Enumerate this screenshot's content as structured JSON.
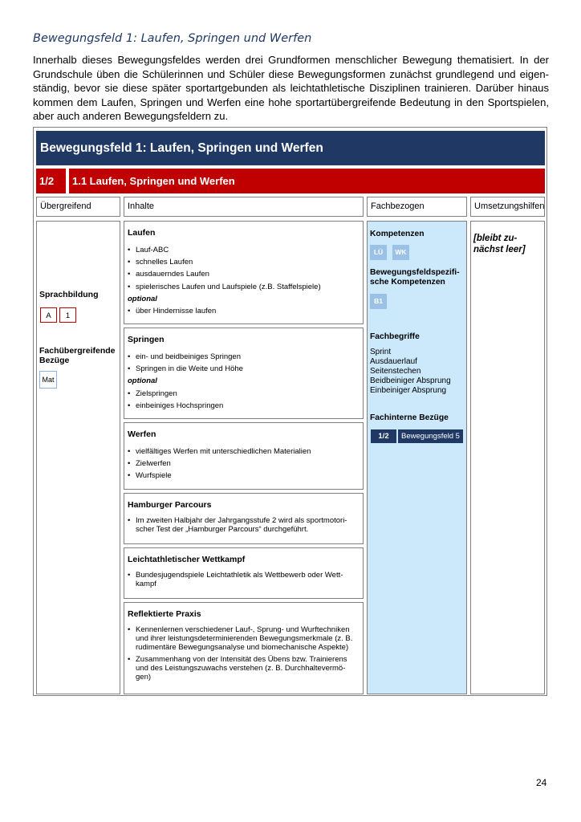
{
  "heading": "Bewegungsfeld 1: Laufen, Springen und Werfen",
  "intro": [
    "Innerhalb dieses Bewegungsfeldes werden drei Grundformen menschlicher Bewegung thematisiert. In der",
    "Grundschule üben die Schülerinnen und Schüler diese Bewegungsformen zunächst grundlegend und eigen-",
    "ständig, bevor sie diese später sportartgebunden als leichtathletische Disziplinen trainieren. Darüber hinaus",
    "kommen dem Laufen, Springen und Werfen eine hohe sportartübergreifende Bedeutung in den Sportspielen,",
    "aber auch anderen Bewegungsfeldern zu."
  ],
  "table": {
    "title": "Bewegungsfeld 1: Laufen, Springen und Werfen",
    "unit_number": "1/2",
    "unit_title": "1.1 Laufen, Springen und Werfen",
    "columns": [
      "Übergreifend",
      "Inhalte",
      "Fachbezogen",
      "Umsetzungshilfen"
    ],
    "uebergreifend": {
      "sprachbildung_label": "Sprachbildung",
      "sprachbildung_tags": [
        "A",
        "1"
      ],
      "fachuebergreifend_label": [
        "Fachübergreifende",
        "Bezüge"
      ],
      "fachuebergreifend_tag": "Mat"
    },
    "inhalte": [
      {
        "title": "Laufen",
        "items": [
          {
            "text": "Lauf-ABC"
          },
          {
            "text": "schnelles Laufen"
          },
          {
            "text": "ausdauerndes Laufen"
          },
          {
            "text": "spielerisches Laufen und Laufspiele (z.B. Staffelspiele)"
          },
          {
            "text": "optional",
            "optional": true
          },
          {
            "text": "über Hindernisse laufen"
          }
        ]
      },
      {
        "title": "Springen",
        "items": [
          {
            "text": "ein- und beidbeiniges Springen"
          },
          {
            "text": "Springen in die Weite und Höhe"
          },
          {
            "text": "optional",
            "optional": true
          },
          {
            "text": "Zielspringen"
          },
          {
            "text": "einbeiniges Hochspringen"
          }
        ]
      },
      {
        "title": "Werfen",
        "items": [
          {
            "text": "vielfältiges Werfen mit unterschiedlichen Materialien"
          },
          {
            "text": "Zielwerfen"
          },
          {
            "text": "Wurfspiele"
          }
        ]
      },
      {
        "title": "Hamburger Parcours",
        "items": [
          {
            "text": "Im zweiten Halbjahr der Jahrgangsstufe 2 wird als sportmotori- scher Test der „Hamburger Parcours“ durchgeführt."
          }
        ]
      },
      {
        "title": "Leichtathletischer Wettkampf",
        "items": [
          {
            "text": "Bundesjugendspiele Leichtathletik als Wettbewerb oder Wett- kampf"
          }
        ]
      },
      {
        "title": "Reflektierte Praxis",
        "items": [
          {
            "text": "Kennenlernen verschiedener Lauf-, Sprung- und Wurftechniken und ihrer leistungsdeterminierenden Bewegungsmerkmale (z. B. rudimentäre Bewegungsanalyse und biomechanische Aspekte)"
          },
          {
            "text": "Zusammenhang von der Intensität des Übens bzw. Trainierens und des Leistungszuwachs verstehen (z. B. Durchhaltevermö- gen)"
          }
        ]
      }
    ],
    "fachbezogen": {
      "kompetenzen_label": "Kompetenzen",
      "kompetenzen_chips": [
        "LÜ",
        "WK"
      ],
      "bfs_label": [
        "Bewegungsfeldspezifi-",
        "sche Kompetenzen"
      ],
      "bfs_chip": "B1",
      "fachbegriffe_label": "Fachbegriffe",
      "fachbegriffe": [
        "Sprint",
        "Ausdauerlauf",
        "Seitenstechen",
        "Beidbeiniger Absprung",
        "Einbeiniger Absprung"
      ],
      "fachintern_label": "Fachinterne Bezüge",
      "fachintern_ref_num": "1/2",
      "fachintern_ref_label": "Bewegungsfeld 5"
    },
    "umsetzungshilfen_text": [
      "[bleibt zu-",
      "nächst leer]"
    ]
  },
  "page_number": "24",
  "colors": {
    "navy": "#1f3864",
    "red": "#c00000",
    "light_blue": "#cce8fb",
    "chip_blue": "#9bc2e6"
  }
}
